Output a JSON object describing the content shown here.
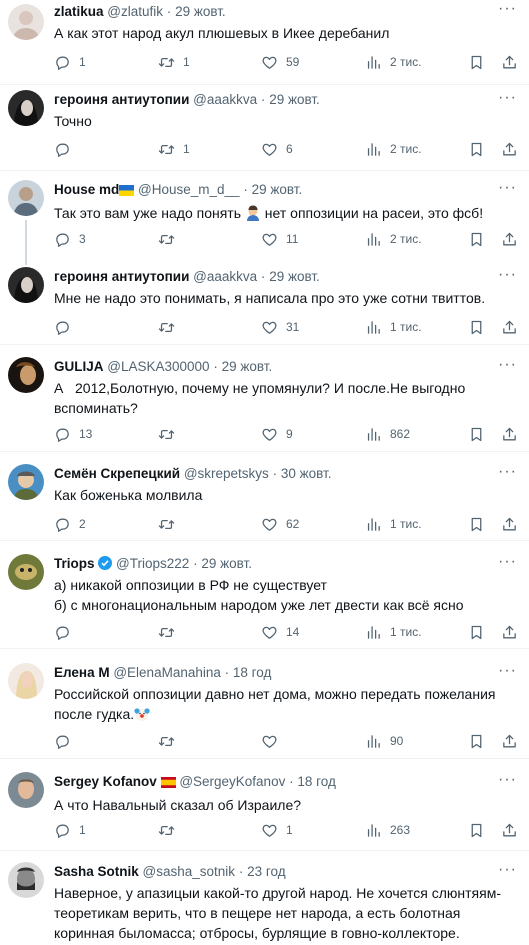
{
  "tweets": [
    {
      "name": "zlatikua",
      "handle": "@zlatufik",
      "time": "29 жовт.",
      "text": "А как этот народ акул плюшевых в Икее деребанил",
      "replies": "1",
      "retweets": "1",
      "likes": "59",
      "views": "2 тис."
    },
    {
      "name": "героиня антиутопии",
      "handle": "@aaakkva",
      "time": "29 жовт.",
      "text": "Точно",
      "replies": "",
      "retweets": "1",
      "likes": "6",
      "views": "2 тис."
    },
    {
      "name": "House md",
      "handle": "@House_m_d__",
      "time": "29 жовт.",
      "text_before": "Так это вам уже надо понять",
      "text_after": " нет оппозиции на расеи, это фсб!",
      "replies": "3",
      "retweets": "",
      "likes": "11",
      "views": "2 тис."
    },
    {
      "name": "героиня антиутопии",
      "handle": "@aaakkva",
      "time": "29 жовт.",
      "text": "Мне не надо это понимать, я написала про это уже сотни твиттов.",
      "replies": "",
      "retweets": "",
      "likes": "31",
      "views": "1 тис."
    },
    {
      "name": "GULIJA",
      "handle": "@LASKA300000",
      "time": "29 жовт.",
      "text": "А   2012,Болотную, почему не упомянули? И после.Не выгодно вспоминать?",
      "replies": "13",
      "retweets": "",
      "likes": "9",
      "views": "862"
    },
    {
      "name": "Семён Скрепецкий",
      "handle": "@skrepetskys",
      "time": "30 жовт.",
      "text": "Как боженька молвила",
      "replies": "2",
      "retweets": "",
      "likes": "62",
      "views": "1 тис."
    },
    {
      "name": "Triops",
      "handle": "@Triops222",
      "time": "29 жовт.",
      "text_lines": [
        "а) никакой оппозиции в РФ не существует",
        "б) с многонациональным народом уже лет двести как всё ясно"
      ],
      "replies": "",
      "retweets": "",
      "likes": "14",
      "views": "1 тис."
    },
    {
      "name": "Елена М",
      "handle": "@ElenaManahina",
      "time": "18 год",
      "text": "Российской оппозиции давно нет дома, можно передать пожелания после гудка.",
      "replies": "",
      "retweets": "",
      "likes": "",
      "views": "90"
    },
    {
      "name": "Sergey Kofanov",
      "handle": "@SergeyKofanov",
      "time": "18 год",
      "text": "А что Навальный сказал об Израиле?",
      "replies": "1",
      "retweets": "",
      "likes": "1",
      "views": "263"
    },
    {
      "name": "Sasha Sotnik",
      "handle": "@sasha_sotnik",
      "time": "23 год",
      "text": "Наверное, у апазицыи какой-то другой народ. Не хочется слюнтяям-теоретикам верить, что в пещере нет народа, а есть болотная коринная быломасса; отбросы, бурлящие в говно-коллекторе."
    }
  ],
  "sep": "·",
  "more": "···",
  "icons": {
    "reply": "reply-icon",
    "retweet": "retweet-icon",
    "like": "heart-icon",
    "views": "views-icon",
    "bookmark": "bookmark-icon",
    "share": "share-icon"
  },
  "colors": {
    "text": "#0f1419",
    "muted": "#536471",
    "verified": "#1d9bf0",
    "border": "#eff3f4"
  }
}
